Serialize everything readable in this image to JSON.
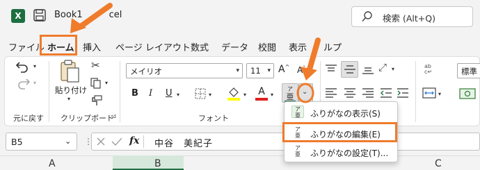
{
  "titlebar": {
    "logo_letter": "X",
    "doc_title": "Book1",
    "doc_title_tail": "cel",
    "search_text": "検索 (Alt+Q)"
  },
  "tabs": [
    "ファイル",
    "ホーム",
    "挿入",
    "ページ レイアウト",
    "数式",
    "データ",
    "校閲",
    "表示",
    "ヘルプ"
  ],
  "tabs_visible": {
    "file": "ファイル",
    "home": "ホーム",
    "insert": "挿入",
    "page_layout": "ページ レイアウト",
    "formulas": "数式",
    "data": "データ",
    "review": "校閲",
    "view": "表示",
    "help_tail": "ルプ"
  },
  "ribbon": {
    "undo_group_label": "元に戻す",
    "paste_label": "貼り付け",
    "clipboard_label": "クリップボード",
    "font_name": "メイリオ",
    "font_size": "11",
    "font_label": "フォント",
    "bold": "B",
    "italic": "I",
    "underline": "U",
    "font_color_letter": "A",
    "grow_font": "A",
    "shrink_font": "A",
    "number_format": "標準",
    "furigana_icon_top": "ア",
    "furigana_icon_bottom": "亜"
  },
  "formula_bar": {
    "name_box": "B5",
    "fx": "fx",
    "content": "中谷　美紀子"
  },
  "columns": [
    "A",
    "B",
    "C"
  ],
  "dropdown": {
    "items": [
      {
        "label": "ふりがなの表示(S)"
      },
      {
        "label": "ふりがなの編集(E)"
      },
      {
        "label": "ふりがなの設定(T)..."
      }
    ]
  },
  "colors": {
    "accent_orange": "#ef7b2b",
    "excel_green": "#1d6f42",
    "font_color_red": "#e02020",
    "fill_yellow": "#ffff00"
  },
  "icons": [
    "excel-logo",
    "save-icon",
    "search-icon",
    "undo-icon",
    "redo-icon",
    "paste-icon",
    "cut-icon",
    "copy-icon",
    "format-painter-icon",
    "border-icon",
    "fill-color-icon",
    "font-color-icon",
    "furigana-icon",
    "chevron-down-icon",
    "align-icon",
    "wrap-icon",
    "merge-icon",
    "fx-icon",
    "cancel-icon",
    "enter-icon"
  ]
}
